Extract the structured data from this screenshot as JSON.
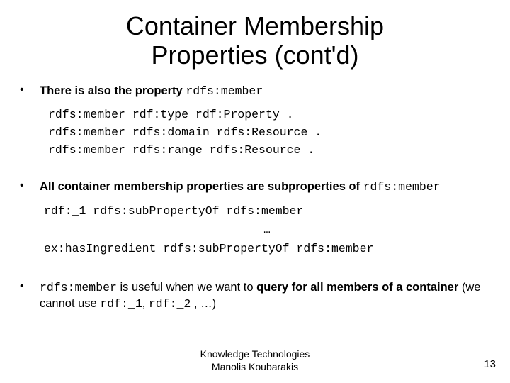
{
  "title_line1": "Container Membership",
  "title_line2": "Properties (cont'd)",
  "b1_intro": "There is also the property ",
  "b1_code": "rdfs:member",
  "codeblock1": "rdfs:member rdf:type rdf:Property .\nrdfs:member rdfs:domain rdfs:Resource .\nrdfs:member rdfs:range rdfs:Resource .",
  "b2_intro": "All container membership properties are subproperties of ",
  "b2_code": "rdfs:member",
  "code2_line1": "rdf:_1 rdfs:subPropertyOf rdfs:member",
  "code2_ellipsis": "…",
  "code2_line2": "ex:hasIngredient rdfs:subPropertyOf rdfs:member",
  "b3_code1": "rdfs:member",
  "b3_part1": " is useful when we want to ",
  "b3_bold": "query for all members of a container",
  "b3_part2": " (we cannot use ",
  "b3_code2": "rdf:_1",
  "b3_part3": ", ",
  "b3_code3": "rdf:_2",
  "b3_part4": " , …)",
  "footer_line1": "Knowledge Technologies",
  "footer_line2": "Manolis Koubarakis",
  "page_number": "13"
}
